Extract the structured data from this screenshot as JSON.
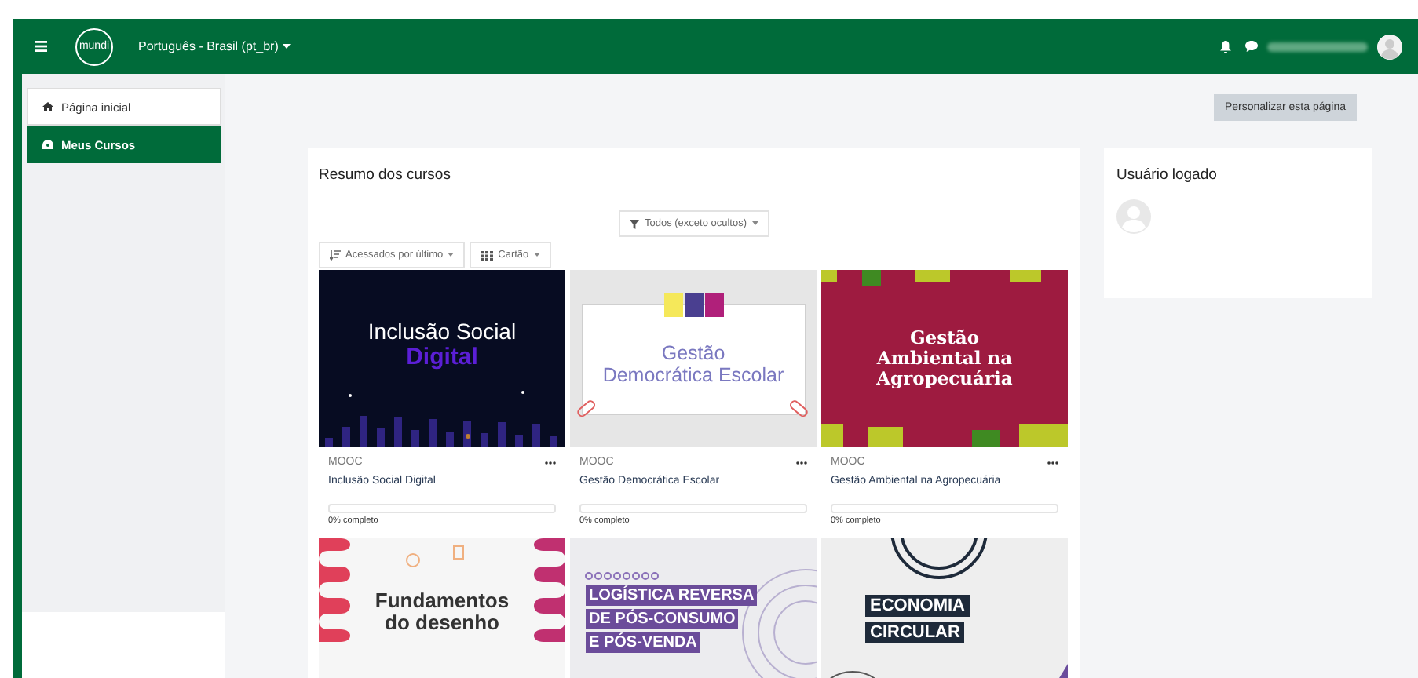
{
  "navbar": {
    "logo": "mundi",
    "language": "Português - Brasil (pt_br)"
  },
  "sidebar": {
    "items": [
      {
        "label": "Página inicial",
        "kind": "home",
        "selected": false
      },
      {
        "label": "Meus Cursos",
        "kind": "courses",
        "selected": true
      }
    ]
  },
  "page_button": "Personalizar esta página",
  "courses_block": {
    "title": "Resumo dos cursos",
    "filter": "Todos (exceto ocultos)",
    "sort": "Acessados por último",
    "view": "Cartão",
    "courses": [
      {
        "kind": "night",
        "cover_lines": [
          "Inclusão Social",
          "Digital"
        ],
        "category": "MOOC",
        "name": "Inclusão Social Digital",
        "level": 0,
        "progress_text": "0% completo"
      },
      {
        "kind": "paper",
        "cover_lines": [
          "Gestão",
          "Democrática Escolar"
        ],
        "category": "MOOC",
        "name": "Gestão Democrática Escolar",
        "level": 0,
        "progress_text": "0% completo"
      },
      {
        "kind": "crimson",
        "cover_lines": [
          "Gestão",
          "Ambiental na",
          "Agropecuária"
        ],
        "category": "MOOC",
        "name": "Gestão Ambiental na Agropecuária",
        "level": 0,
        "progress_text": "0% completo"
      },
      {
        "kind": "waves",
        "cover_lines": [
          "Fundamentos",
          "do desenho"
        ]
      },
      {
        "kind": "labels",
        "cover_lines": [
          "LOGÍSTICA REVERSA",
          "DE PÓS-CONSUMO",
          "E PÓS-VENDA"
        ]
      },
      {
        "kind": "circles",
        "cover_lines": [
          "ECONOMIA",
          "CIRCULAR"
        ]
      }
    ]
  },
  "user_block": {
    "title": "Usuário logado"
  }
}
